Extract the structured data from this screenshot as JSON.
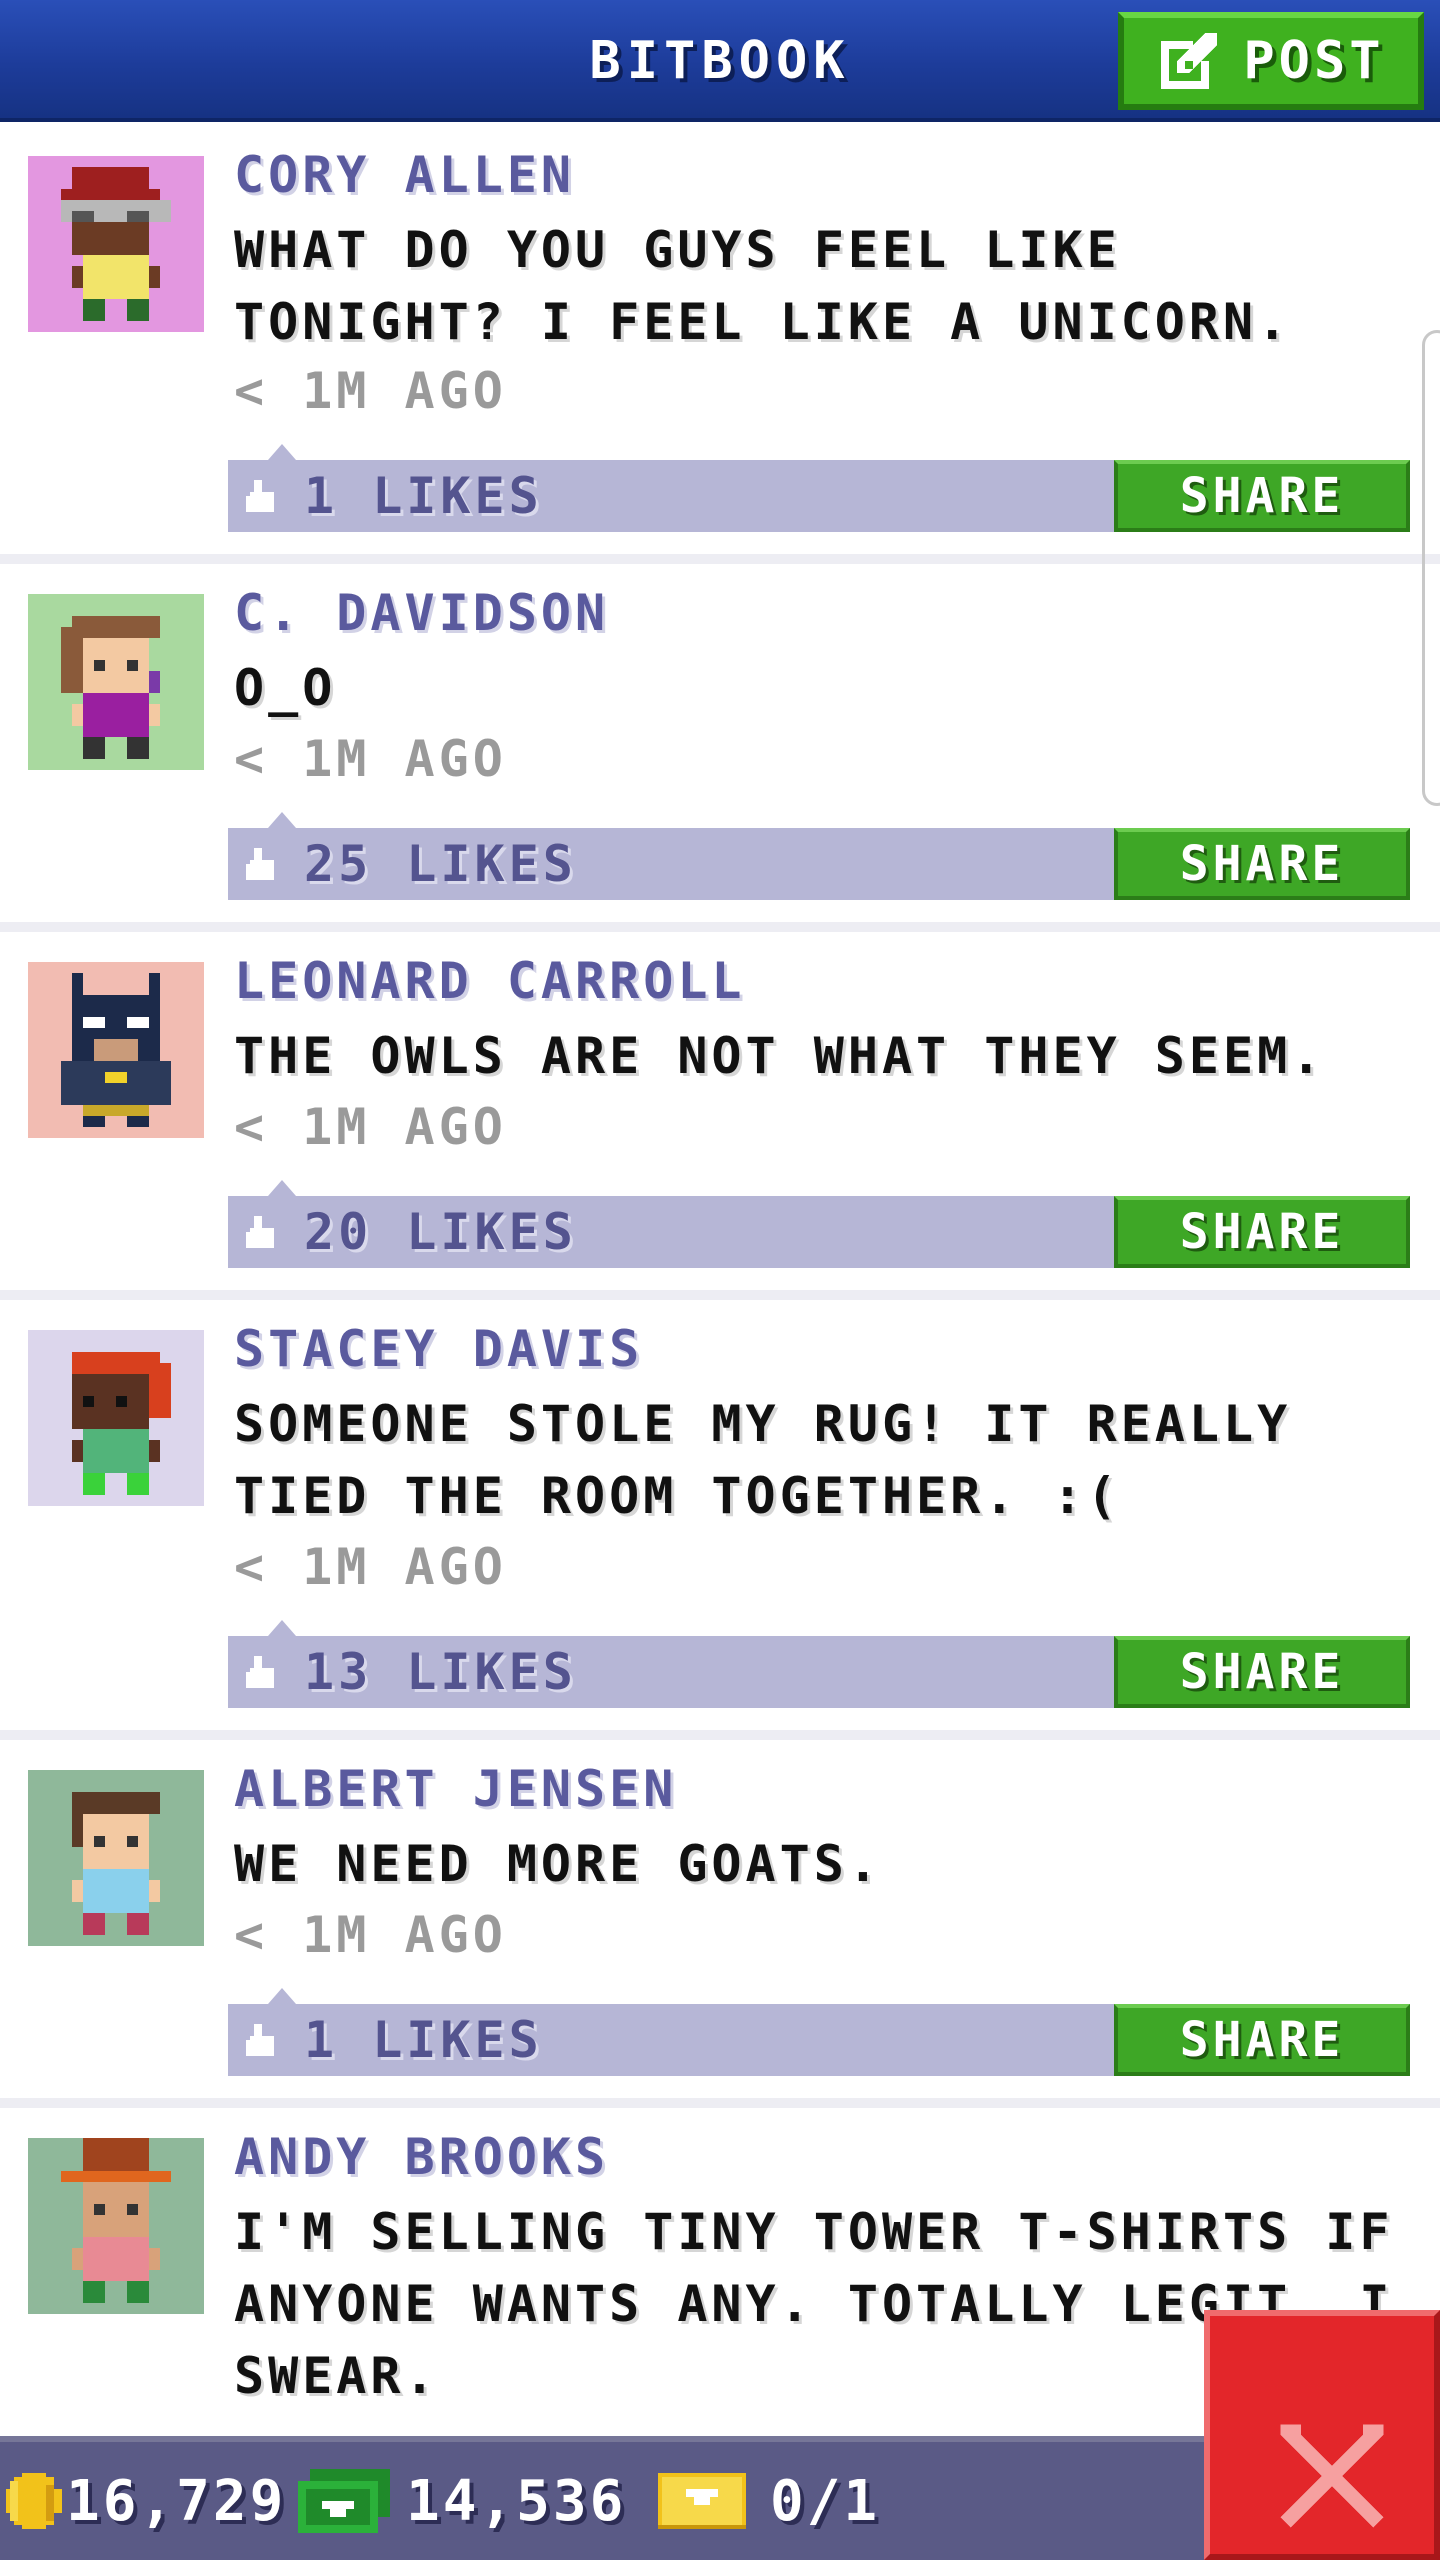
{
  "header": {
    "title": "BITBOOK",
    "post_label": "POST"
  },
  "posts": [
    {
      "author": "CORY ALLEN",
      "message": "WHAT DO YOU GUYS FEEL LIKE\nTONIGHT? I FEEL LIKE A UNICORN.",
      "time": "< 1M AGO",
      "likes": "1 LIKES",
      "share": "SHARE",
      "avatar_bg": "#e397e0"
    },
    {
      "author": "C. DAVIDSON",
      "message": "O_O",
      "time": "< 1M AGO",
      "likes": "25 LIKES",
      "share": "SHARE",
      "avatar_bg": "#a9d99f"
    },
    {
      "author": "LEONARD CARROLL",
      "message": "THE OWLS ARE NOT WHAT THEY SEEM.",
      "time": "< 1M AGO",
      "likes": "20 LIKES",
      "share": "SHARE",
      "avatar_bg": "#f2bcb2"
    },
    {
      "author": "STACEY DAVIS",
      "message": "SOMEONE STOLE MY RUG! IT REALLY\nTIED THE ROOM TOGETHER. :(",
      "time": "< 1M AGO",
      "likes": "13 LIKES",
      "share": "SHARE",
      "avatar_bg": "#dcd6ec"
    },
    {
      "author": "ALBERT JENSEN",
      "message": "WE NEED MORE GOATS.",
      "time": "< 1M AGO",
      "likes": "1 LIKES",
      "share": "SHARE",
      "avatar_bg": "#8fb89a"
    },
    {
      "author": "ANDY BROOKS",
      "message": "I'M SELLING TINY TOWER T-SHIRTS IF\nANYONE WANTS ANY. TOTALLY LEGIT. I\nSWEAR.",
      "avatar_bg": "#8fb89a"
    }
  ],
  "footer": {
    "coins": "16,729",
    "bux": "14,536",
    "tickets": "0/1"
  },
  "colors": {
    "header_blue": "#1d3c9a",
    "post_green": "#3fb11f",
    "share_green": "#3ea726",
    "like_bar": "#b6b6d6",
    "author_purple": "#5a5a9e",
    "close_red": "#e3262a",
    "footer_bg": "#5a5a86"
  },
  "icons": {
    "post": "edit-icon",
    "like": "thumbs-up-icon",
    "coin": "coin-icon",
    "bux": "bux-icon",
    "ticket": "ticket-icon",
    "close": "close-icon"
  }
}
